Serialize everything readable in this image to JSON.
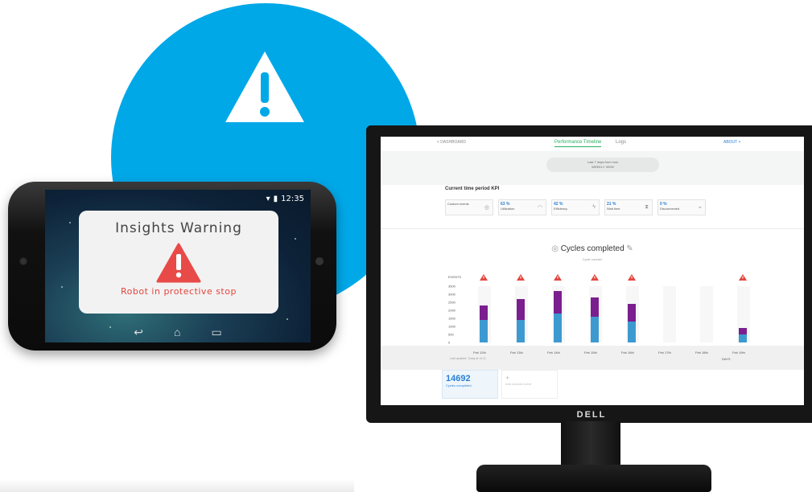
{
  "phone": {
    "status_time": "12:35",
    "card_title": "Insights Warning",
    "card_message": "Robot in protective stop"
  },
  "monitor": {
    "brand": "DELL"
  },
  "dashboard": {
    "nav": {
      "back": "< DASHBOARD",
      "performance": "Performance Timeline",
      "logs": "Logs",
      "about": "ABOUT >"
    },
    "range": {
      "line1": "Last 7 days from now",
      "line2": "WEEKLY VIEW"
    },
    "kpi_title": "Current time period KPI",
    "kpis": [
      {
        "value": "",
        "label": "Custom events",
        "icon": "fingerprint-icon"
      },
      {
        "value": "63 %",
        "label": "Utilization",
        "icon": "gauge-icon"
      },
      {
        "value": "42 %",
        "label": "Efficiency",
        "icon": "bolt-icon"
      },
      {
        "value": "21 %",
        "label": "Wait time",
        "icon": "hourglass-icon"
      },
      {
        "value": "0 %",
        "label": "Disconnected",
        "icon": "unplug-icon"
      }
    ],
    "chart_title": "Cycles completed",
    "chart_subtitle": "Cycle counter",
    "updated": "Last updated: Today at 14:11",
    "days_label": "DAYS",
    "total_value": "14692",
    "total_label": "Cycles completed",
    "add_label": "Add custom event"
  },
  "chart_data": {
    "type": "bar",
    "ylabel": "EVENTS",
    "xlabel": "DAYS",
    "ylim": [
      0,
      3500
    ],
    "yticks": [
      0,
      500,
      1000,
      1500,
      2000,
      2500,
      3000,
      3500
    ],
    "categories": [
      "Feb 12th",
      "Feb 13th",
      "Feb 14th",
      "Feb 15th",
      "Feb 16th",
      "Feb 17th",
      "Feb 18th",
      "Feb 19th"
    ],
    "series": [
      {
        "values": [
          1400,
          1400,
          1800,
          1600,
          1300,
          0,
          0,
          500
        ],
        "color": "#3d9ad1"
      },
      {
        "values": [
          900,
          1300,
          1400,
          1200,
          1100,
          0,
          0,
          400
        ],
        "color": "#7b1e8f"
      }
    ],
    "warnings": [
      true,
      true,
      true,
      true,
      true,
      false,
      false,
      true
    ],
    "colors": {
      "warning": "#e3453d",
      "primary": "#3d9ad1",
      "secondary": "#7b1e8f"
    }
  }
}
